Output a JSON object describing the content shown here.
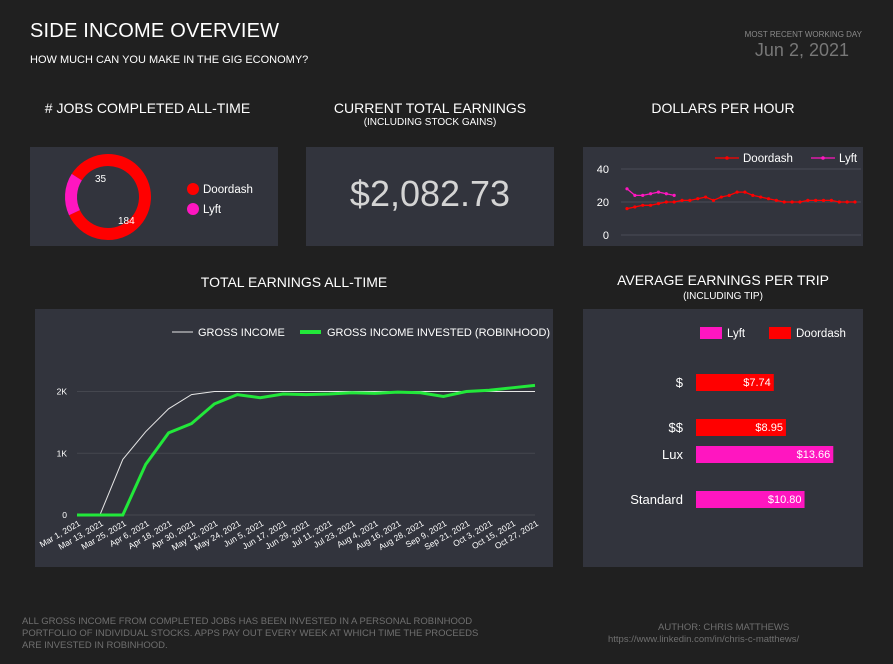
{
  "header": {
    "title": "SIDE INCOME OVERVIEW",
    "subtitle": "HOW MUCH CAN YOU MAKE IN THE GIG ECONOMY?",
    "recent_label": "MOST RECENT WORKING DAY",
    "recent_date": "Jun 2, 2021"
  },
  "sections": {
    "jobs": "# JOBS COMPLETED ALL-TIME",
    "earnings": "CURRENT TOTAL EARNINGS",
    "earnings_sub": "(INCLUDING STOCK GAINS)",
    "dph": "DOLLARS PER HOUR",
    "total": "TOTAL EARNINGS ALL-TIME",
    "avg": "AVERAGE EARNINGS PER TRIP",
    "avg_sub": "(INCLUDING TIP)"
  },
  "kpi": {
    "total_earnings": "$2,082.73"
  },
  "footer": {
    "note_lines": [
      "ALL GROSS INCOME FROM COMPLETED JOBS HAS BEEN INVESTED IN A PERSONAL ROBINHOOD",
      "PORTFOLIO OF INDIVIDUAL STOCKS. APPS PAY OUT EVERY WEEK AT WHICH TIME THE PROCEEDS",
      "ARE INVESTED IN ROBINHOOD."
    ],
    "author": "AUTHOR: CHRIS MATTHEWS",
    "url": "https://www.linkedin.com/in/chris-c-matthews/"
  },
  "colors": {
    "doordash": "#ff0000",
    "lyft": "#ff16c0",
    "invested": "#22e83a",
    "gross": "#e6e6e6",
    "panel": "#32343d"
  },
  "chart_data": [
    {
      "type": "pie",
      "labels": [
        "Doordash",
        "Lyft"
      ],
      "values": [
        184,
        35
      ],
      "legend_position": "right"
    },
    {
      "type": "line",
      "series": [
        {
          "name": "Doordash",
          "values": [
            16,
            17,
            18,
            18,
            19,
            20,
            20,
            21,
            21,
            22,
            23,
            21,
            23,
            24,
            26,
            26,
            24,
            23,
            22,
            21,
            20,
            20,
            20,
            21,
            21,
            21,
            21,
            20,
            20,
            20
          ]
        },
        {
          "name": "Lyft",
          "values": [
            28,
            24,
            24,
            25,
            26,
            25,
            24
          ]
        }
      ],
      "yticks": [
        0,
        20,
        40
      ],
      "ylim": [
        0,
        40
      ],
      "grid": true,
      "legend_position": "top-right"
    },
    {
      "type": "line",
      "x": [
        "Mar 1, 2021",
        "Mar 13, 2021",
        "Mar 25, 2021",
        "Apr 6, 2021",
        "Apr 18, 2021",
        "Apr 30, 2021",
        "May 12, 2021",
        "May 24, 2021",
        "Jun 5, 2021",
        "Jun 17, 2021",
        "Jun 29, 2021",
        "Jul 11, 2021",
        "Jul 23, 2021",
        "Aug 4, 2021",
        "Aug 16, 2021",
        "Aug 28, 2021",
        "Sep 9, 2021",
        "Sep 21, 2021",
        "Oct 3, 2021",
        "Oct 15, 2021",
        "Oct 27, 2021"
      ],
      "series": [
        {
          "name": "GROSS INCOME",
          "values": [
            0,
            0,
            900,
            1350,
            1720,
            1950,
            2000,
            2000,
            2000,
            2000,
            2000,
            2000,
            2000,
            2000,
            2000,
            2000,
            2000,
            2000,
            2000,
            2000,
            2000
          ]
        },
        {
          "name": "GROSS INCOME INVESTED (ROBINHOOD)",
          "values": [
            0,
            0,
            0,
            820,
            1330,
            1480,
            1800,
            1950,
            1900,
            1960,
            1950,
            1960,
            1980,
            1970,
            1990,
            1980,
            1920,
            2000,
            2020,
            2060,
            2100
          ]
        }
      ],
      "yticks": [
        "0",
        "1K",
        "2K"
      ],
      "ytick_values": [
        0,
        1000,
        2000
      ],
      "ylim": [
        0,
        2300
      ],
      "grid": true,
      "legend_position": "top-right"
    },
    {
      "type": "bar",
      "orientation": "horizontal",
      "categories": [
        "$",
        "$$",
        "Lux",
        "Standard"
      ],
      "series": [
        {
          "name": "Lyft",
          "values": [
            null,
            null,
            13.66,
            10.8
          ]
        },
        {
          "name": "Doordash",
          "values": [
            7.74,
            8.95,
            null,
            null
          ]
        }
      ],
      "labels": [
        "$7.74",
        "$8.95",
        "$13.66",
        "$10.80"
      ],
      "legend_position": "top"
    }
  ]
}
